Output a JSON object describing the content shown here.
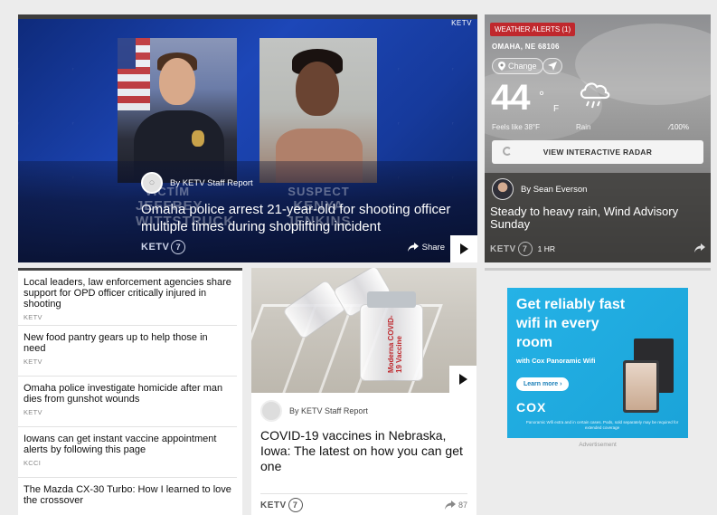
{
  "hero": {
    "source": "KETV",
    "caption_victim_line1": "VICTIM",
    "caption_victim_line2": "JEFFREY WITTSTRUCK",
    "caption_suspect_line1": "SUSPECT",
    "caption_suspect_line2": "KENYA JENKINS",
    "author": "By KETV Staff Report",
    "headline": "Omaha police arrest 21-year-old for shooting officer multiple times during shoplifting incident",
    "logo": "KETV",
    "share_label": "Share"
  },
  "weather": {
    "alert": "WEATHER ALERTS (1)",
    "location": "OMAHA, NE 68106",
    "change_label": "Change",
    "temperature": "44",
    "degree": "°",
    "unit": "F",
    "feels_like": "Feels like 38°F",
    "condition": "Rain",
    "precip": "100%",
    "radar_button": "VIEW INTERACTIVE RADAR",
    "author": "By Sean Everson",
    "headline": "Steady to heavy rain, Wind Advisory Sunday",
    "logo": "KETV",
    "time": "1 HR"
  },
  "stories": [
    {
      "title": "Local leaders, law enforcement agencies share support for OPD officer critically injured in shooting",
      "source": "KETV"
    },
    {
      "title": "New food pantry gears up to help those in need",
      "source": "KETV"
    },
    {
      "title": "Omaha police investigate homicide after man dies from gunshot wounds",
      "source": "KETV"
    },
    {
      "title": "Iowans can get instant vaccine appointment alerts by following this page",
      "source": "KCCI"
    },
    {
      "title": "The Mazda CX-30 Turbo: How I learned to love the crossover",
      "source": ""
    }
  ],
  "feature": {
    "vial_label": "Moderna COVID-19 Vaccine",
    "author": "By KETV Staff Report",
    "headline": "COVID-19 vaccines in Nebraska, Iowa: The latest on how you can get one",
    "logo": "KETV",
    "share_count": "87"
  },
  "ad": {
    "headline": "Get reliably fast wifi in every room",
    "sub": "with Cox Panoramic Wifi",
    "cta": "Learn more ›",
    "brand": "COX",
    "fine_print": "Panoramic Wifi extra and in certain cases. Pods, sold separately may be required for extended coverage",
    "label": "Advertisement"
  },
  "colors": {
    "alert_red": "#c0282d",
    "hero_blue": "#1d47b8",
    "ad_blue": "#25b2e6"
  },
  "icons": [
    "location-pin-icon",
    "locate-arrow-icon",
    "rain-cloud-icon",
    "radar-icon",
    "share-icon",
    "play-icon",
    "ketv-logo"
  ]
}
